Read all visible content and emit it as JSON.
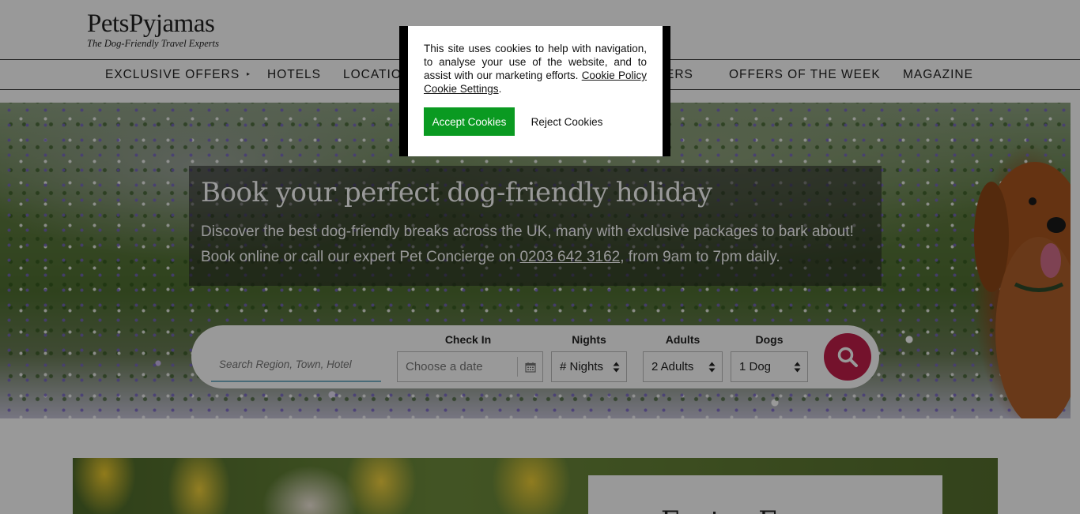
{
  "brand": {
    "name": "PetsPyjamas",
    "tagline": "The Dog-Friendly Travel Experts"
  },
  "nav": {
    "items": [
      {
        "label": "EXCLUSIVE OFFERS"
      },
      {
        "label": "HOTELS"
      },
      {
        "label": "LOCATIO"
      },
      {
        "label": "ERS"
      },
      {
        "label": "OFFERS OF THE WEEK"
      },
      {
        "label": "MAGAZINE"
      }
    ],
    "dropdown_marker": "▸"
  },
  "hero": {
    "title": "Book your perfect dog-friendly holiday",
    "line1": "Discover the best dog-friendly breaks across the UK, many with exclusive packages to bark about!",
    "line2_prefix": "Book online or call our expert Pet Concierge on ",
    "phone": "0203 642 3162",
    "line2_suffix": ", from 9am to 7pm daily."
  },
  "search": {
    "placeholder": "Search Region, Town, Hotel",
    "checkin_label": "Check In",
    "checkin_placeholder": "Choose a date",
    "nights_label": "Nights",
    "nights_value": "# Nights",
    "adults_label": "Adults",
    "adults_value": "2 Adults",
    "dogs_label": "Dogs",
    "dogs_value": "1 Dog"
  },
  "promo": {
    "title": "Easter Escapes"
  },
  "cookie": {
    "message": "This site uses cookies to help with navigation, to analyse your use of the website, and to assist with our marketing efforts. ",
    "policy_link": "Cookie Policy",
    "settings_link": "Cookie Settings",
    "period": ".",
    "accept_label": "Accept Cookies",
    "reject_label": "Reject Cookies"
  },
  "colors": {
    "accept": "#0a9a21",
    "search_button": "#c21f4a",
    "input_underline": "#7ab3c8"
  }
}
